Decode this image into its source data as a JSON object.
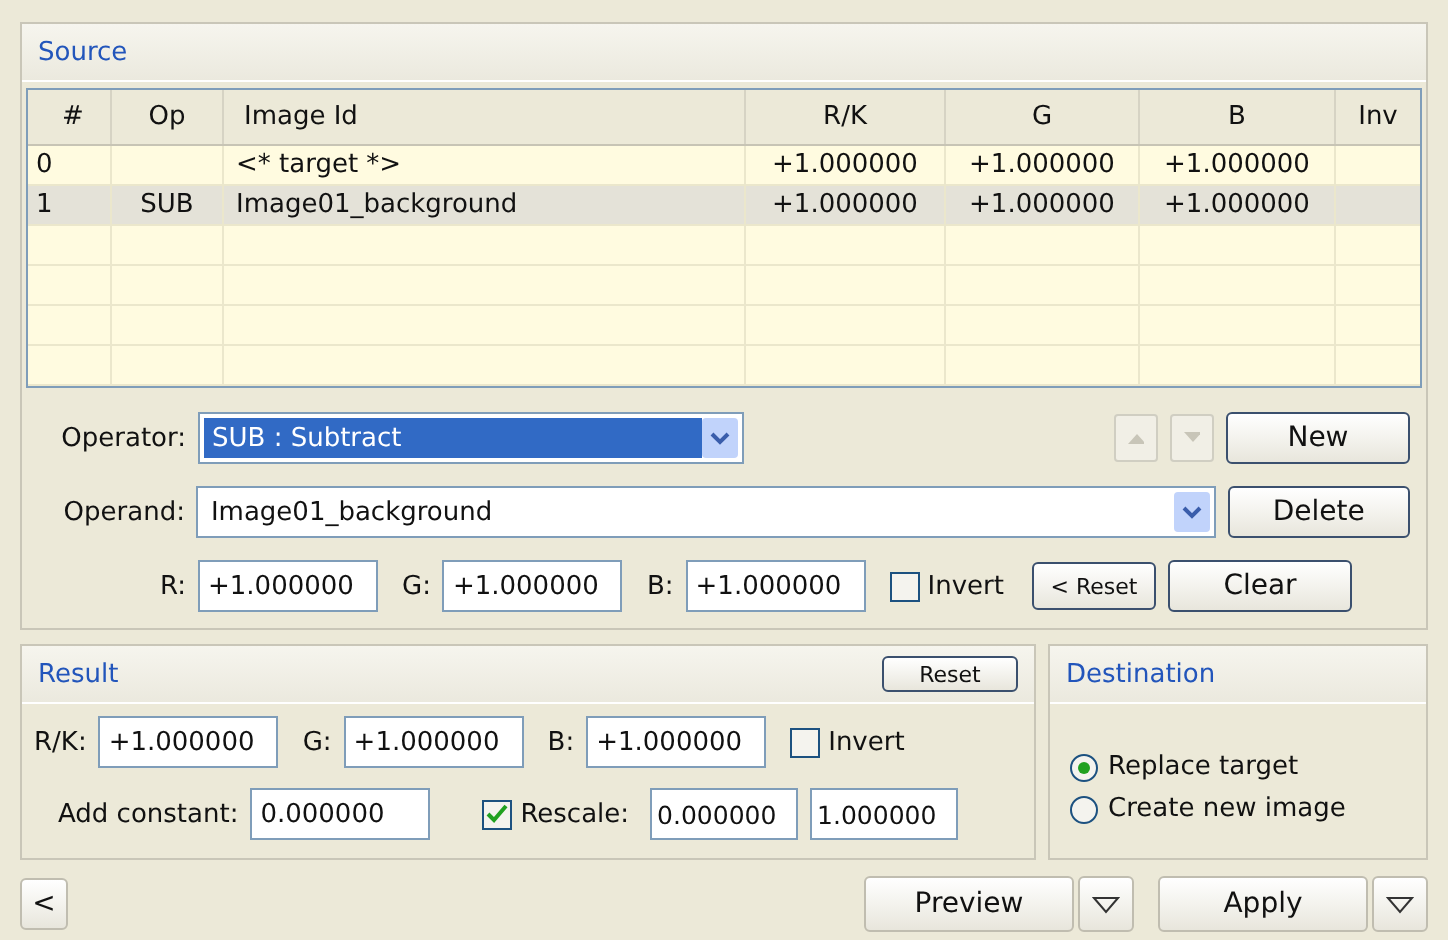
{
  "source": {
    "title": "Source",
    "table": {
      "columns": [
        "#",
        "Op",
        "Image Id",
        "R/K",
        "G",
        "B",
        "Inv"
      ],
      "rows": [
        {
          "index": "0",
          "image_id": "<* target *>",
          "r_k": "+1.000000",
          "g": "+1.000000",
          "b": "+1.000000",
          "selected": false
        },
        {
          "index": "1",
          "op": "SUB",
          "image_id": "Image01_background",
          "r_k": "+1.000000",
          "g": "+1.000000",
          "b": "+1.000000",
          "selected": true
        }
      ]
    },
    "operator": {
      "label": "Operator:",
      "value": "SUB : Subtract",
      "focused": true
    },
    "operand": {
      "label": "Operand:",
      "value": "Image01_background"
    },
    "move_buttons": {
      "disabled": true
    },
    "buttons": [
      "New",
      "Delete",
      "Clear"
    ],
    "weights": [
      {
        "label": "R:",
        "value": "+1.000000"
      },
      {
        "label": "G:",
        "value": "+1.000000"
      },
      {
        "label": "B:",
        "value": "+1.000000"
      }
    ],
    "invert": {
      "label": "Invert",
      "checked": false
    },
    "reset_button": "< Reset"
  },
  "result": {
    "title": "Result",
    "reset_button": "Reset",
    "weights": [
      {
        "label": "R/K:",
        "value": "+1.000000"
      },
      {
        "label": "G:",
        "value": "+1.000000"
      },
      {
        "label": "B:",
        "value": "+1.000000"
      }
    ],
    "invert": {
      "label": "Invert",
      "checked": false
    },
    "add_constant": {
      "label": "Add constant:",
      "value": "0.000000"
    },
    "rescale": {
      "label": "Rescale:",
      "checked": true,
      "min": "0.000000",
      "max": "1.000000"
    }
  },
  "destination": {
    "title": "Destination",
    "options": [
      {
        "label": "Replace target",
        "selected": true
      },
      {
        "label": "Create new image",
        "selected": false
      }
    ]
  },
  "footer": {
    "back_button": "<",
    "preview_button": "Preview",
    "apply_button": "Apply"
  }
}
